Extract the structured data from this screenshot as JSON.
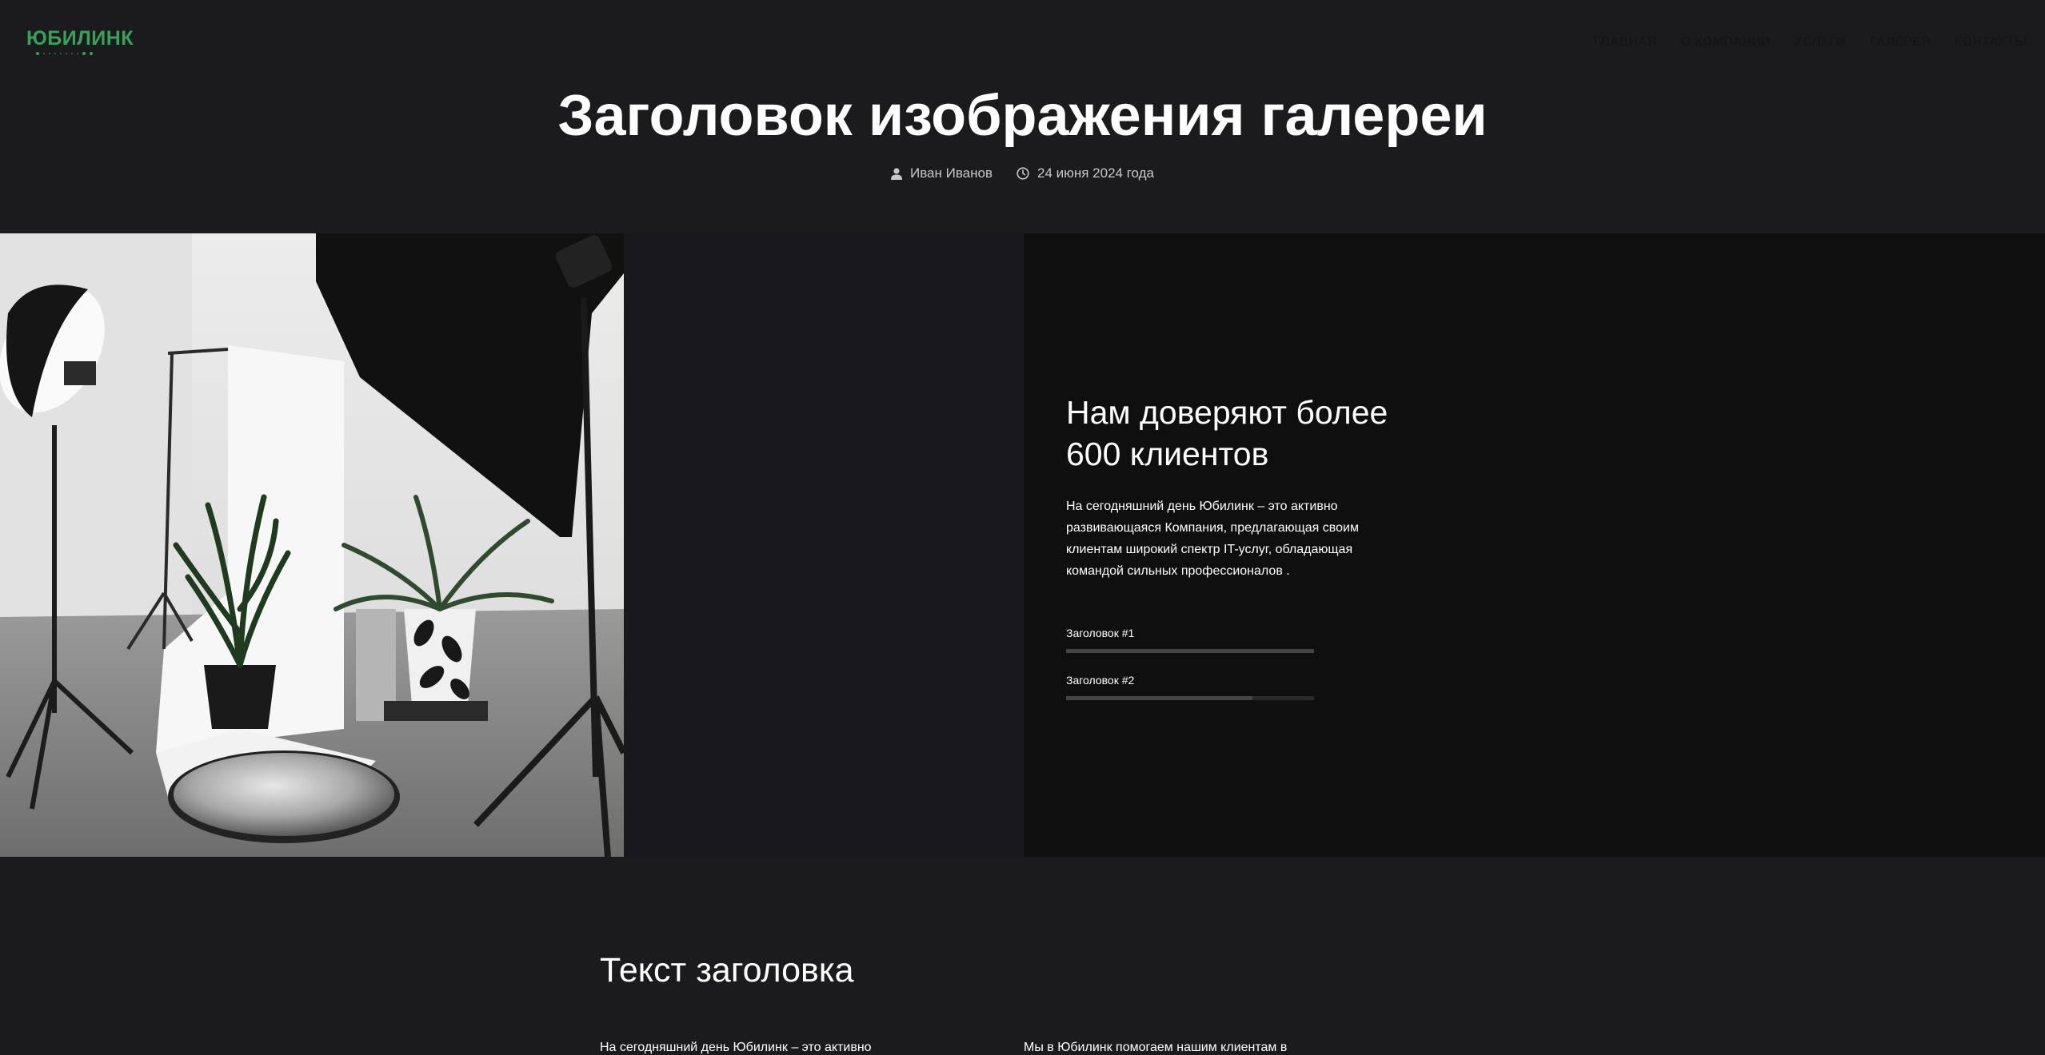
{
  "header": {
    "logo_text": "ЮБИЛИНК",
    "nav": [
      "ГЛАВНАЯ",
      "О КОМПАНИИ",
      "УСЛУГИ",
      "ГАЛЕРЕЯ",
      "КОНТАКТЫ"
    ]
  },
  "post": {
    "title": "Заголовок изображения галереи",
    "author": "Иван Иванов",
    "date": "24 июня 2024 года",
    "author_icon": "user-icon",
    "date_icon": "clock-icon"
  },
  "about": {
    "heading_line1": "Нам доверяют более",
    "heading_line2": "600 клиентов",
    "text": "На сегодняшний день Юбилинк – это активно развивающаяся Компания, предлагающая своим клиентам широкий спектр IT-услуг, обладающая командой сильных профессионалов .",
    "skills": [
      {
        "label": "Заголовок #1",
        "level": 1.0
      },
      {
        "label": "Заголовок #2",
        "level": 0.75
      }
    ]
  },
  "section": {
    "heading": "Текст заголовка",
    "col1_text": "На сегодняшний день Юбилинк – это активно",
    "col2_text": "Мы в Юбилинк помогаем нашим клиентам в"
  },
  "colors": {
    "background": "#1b1b1d",
    "panel": "#0f0f0f",
    "brand_green": "#3aa05a",
    "nav_text": "#151515"
  }
}
